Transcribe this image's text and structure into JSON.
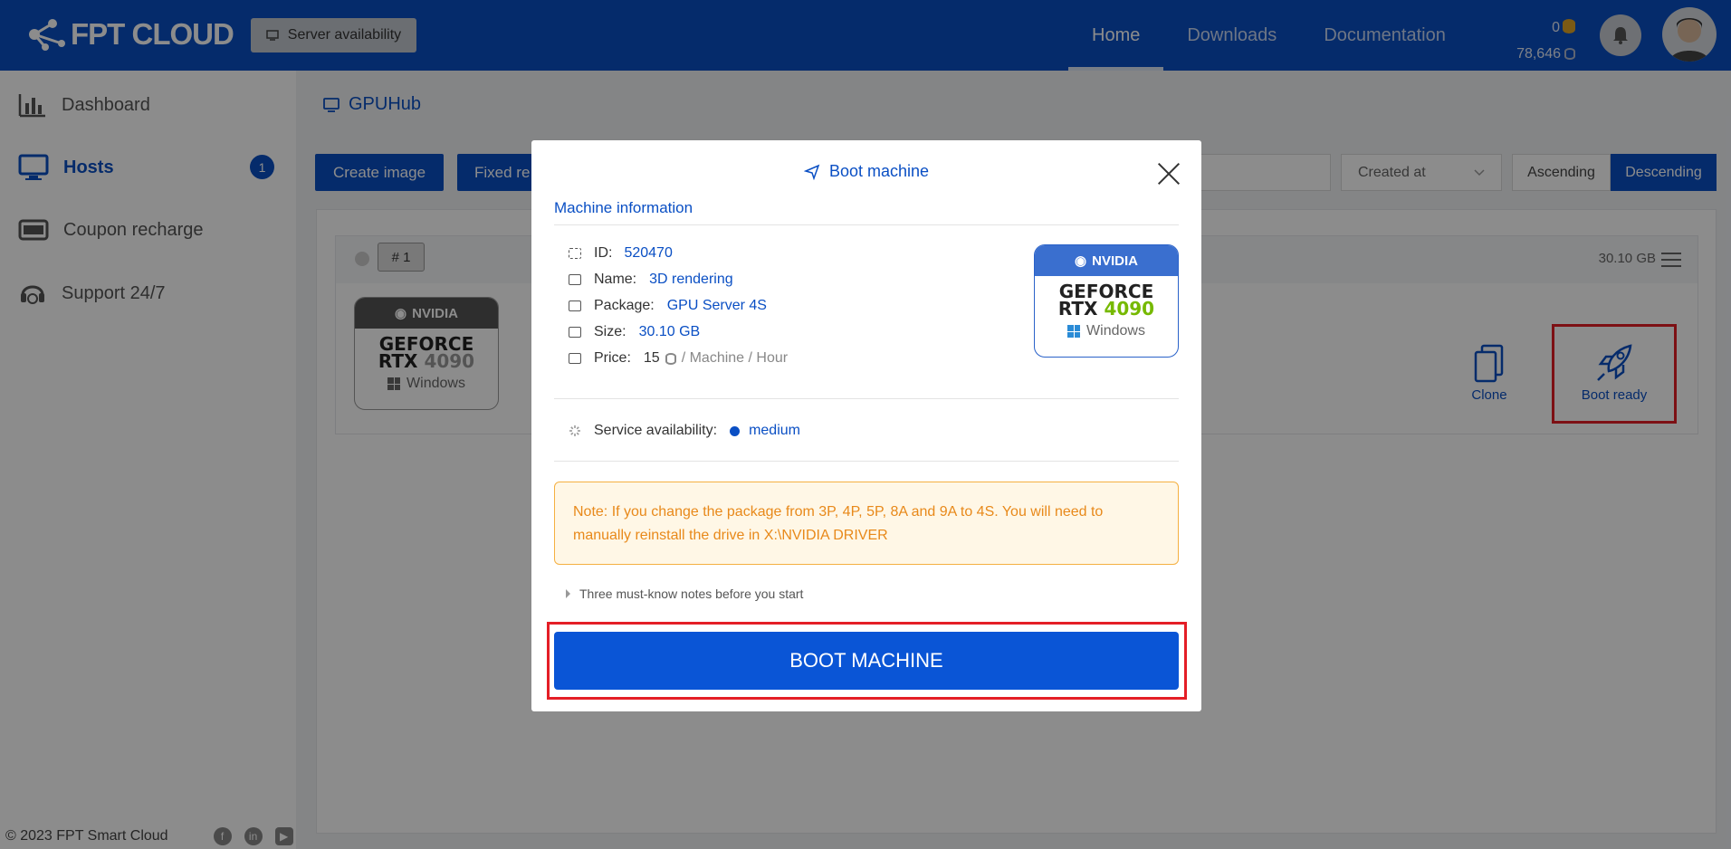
{
  "header": {
    "logo_text": "FPT CLOUD",
    "server_availability": "Server availability",
    "nav": [
      "Home",
      "Downloads",
      "Documentation"
    ],
    "coins": "0",
    "credits": "78,646"
  },
  "sidebar": {
    "items": [
      {
        "label": "Dashboard",
        "icon": "chart-icon"
      },
      {
        "label": "Hosts",
        "icon": "monitor-icon",
        "badge": "1"
      },
      {
        "label": "Coupon recharge",
        "icon": "card-icon"
      },
      {
        "label": "Support 24/7",
        "icon": "headset-icon"
      }
    ],
    "footer": "© 2023 FPT Smart Cloud"
  },
  "main": {
    "breadcrumb": "GPUHub",
    "toolbar": {
      "create_image": "Create image",
      "fixed": "Fixed re",
      "sort_field": "Created at",
      "ascending": "Ascending",
      "descending": "Descending"
    },
    "card": {
      "number": "# 1",
      "size": "30.10 GB",
      "clone": "Clone",
      "boot_ready": "Boot ready"
    }
  },
  "gpu": {
    "brand": "NVIDIA",
    "line1": "GEFORCE",
    "line2a": "RTX",
    "line2b": "4090",
    "os": "Windows"
  },
  "modal": {
    "title": "Boot machine",
    "section": "Machine information",
    "info": {
      "id_label": "ID:",
      "id_value": "520470",
      "name_label": "Name:",
      "name_value": "3D rendering",
      "package_label": "Package:",
      "package_value": "GPU Server 4S",
      "size_label": "Size:",
      "size_value": "30.10 GB",
      "price_label": "Price:",
      "price_value": "15",
      "price_unit": "/ Machine / Hour"
    },
    "service_label": "Service availability:",
    "service_value": "medium",
    "note": "Note: If you change the package from 3P, 4P, 5P, 8A and 9A to 4S. You will need to manually reinstall the drive in X:\\NVIDIA DRIVER",
    "musts": "Three must-know notes before you start",
    "boot_button": "BOOT MACHINE"
  }
}
